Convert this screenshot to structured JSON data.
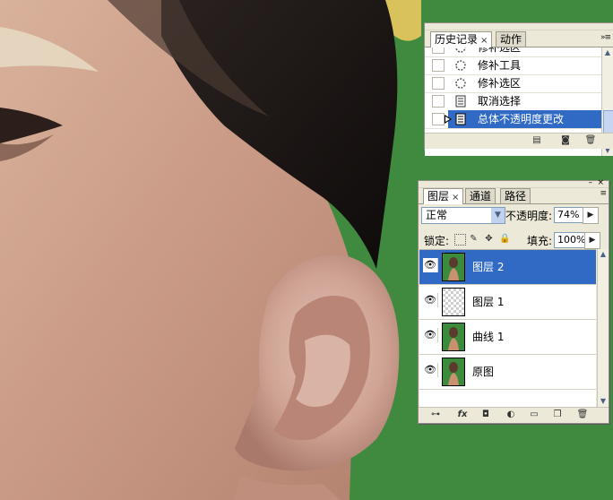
{
  "history_panel": {
    "tabs": [
      {
        "label": "历史记录",
        "close": "×"
      },
      {
        "label": "动作"
      }
    ],
    "menu_icon": "»≡",
    "items": [
      {
        "label": "修补选区",
        "icon": "patch-tool-icon"
      },
      {
        "label": "修补工具",
        "icon": "patch-tool-icon"
      },
      {
        "label": "修补选区",
        "icon": "patch-tool-icon"
      },
      {
        "label": "取消选择",
        "icon": "document-icon"
      },
      {
        "label": "总体不透明度更改",
        "icon": "document-icon",
        "selected": true
      }
    ],
    "footer_icons": [
      "new-document-from-state-icon",
      "snapshot-icon",
      "trash-icon"
    ]
  },
  "layers_panel": {
    "tabs": [
      {
        "label": "图层",
        "close": "×"
      },
      {
        "label": "通道"
      },
      {
        "label": "路径"
      }
    ],
    "menu_icon": "≡",
    "blend_mode": "正常",
    "opacity_label": "不透明度:",
    "opacity_value": "74%",
    "lock_label": "锁定:",
    "fill_label": "填充:",
    "fill_value": "100%",
    "layers": [
      {
        "name": "图层 2",
        "visible": true,
        "selected": true,
        "thumb": "photo"
      },
      {
        "name": "图层 1",
        "visible": true,
        "selected": false,
        "thumb": "transparent"
      },
      {
        "name": "曲线 1",
        "visible": true,
        "selected": false,
        "thumb": "photo"
      },
      {
        "name": "原图",
        "visible": true,
        "selected": false,
        "thumb": "photo"
      }
    ],
    "footer_icons": [
      "link-layers-icon",
      "fx-icon",
      "add-mask-icon",
      "adjustment-layer-icon",
      "new-group-icon",
      "new-layer-icon",
      "trash-icon"
    ],
    "fx_text": "fx"
  },
  "colors": {
    "selection": "#316ac5",
    "panel_bg": "#ece9d8",
    "canvas_green": "#3f8a3e"
  }
}
